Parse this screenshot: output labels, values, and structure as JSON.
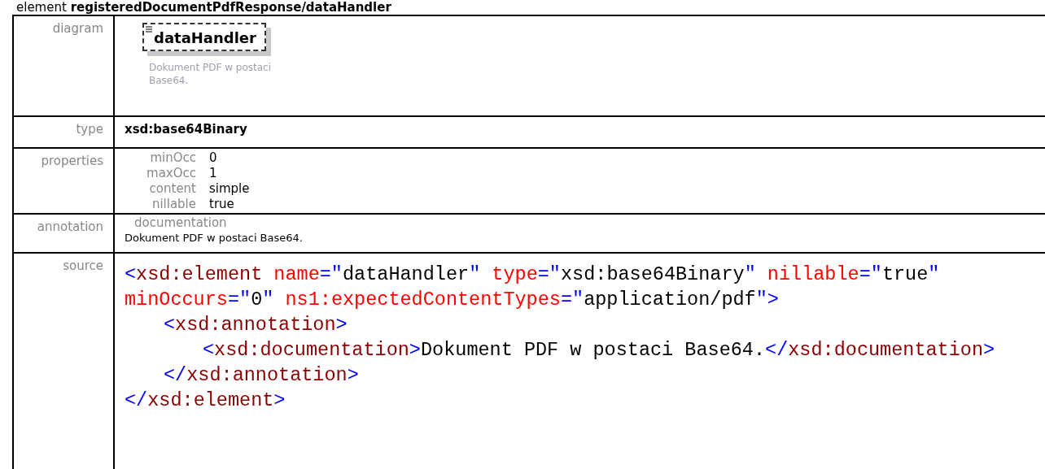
{
  "heading": {
    "prefix": "element",
    "name": "registeredDocumentPdfResponse/dataHandler"
  },
  "diagram": {
    "label": "diagram",
    "element": "dataHandler",
    "caption": "Dokument PDF w postaci Base64."
  },
  "type": {
    "label": "type",
    "value": "xsd:base64Binary"
  },
  "properties": {
    "label": "properties",
    "items": [
      {
        "name": "minOcc",
        "value": "0"
      },
      {
        "name": "maxOcc",
        "value": "1"
      },
      {
        "name": "content",
        "value": "simple"
      },
      {
        "name": "nillable",
        "value": "true"
      }
    ]
  },
  "annotation": {
    "label": "annotation",
    "heading": "documentation",
    "text": "Dokument PDF w postaci Base64."
  },
  "source": {
    "label": "source",
    "lines": [
      {
        "tokens": [
          {
            "kind": "punct",
            "text": "<"
          },
          {
            "kind": "tag",
            "text": "xsd:element "
          },
          {
            "kind": "attr",
            "text": "name"
          },
          {
            "kind": "punct",
            "text": "=\""
          },
          {
            "kind": "text",
            "text": "dataHandler"
          },
          {
            "kind": "punct",
            "text": "\" "
          },
          {
            "kind": "attr",
            "text": "type"
          },
          {
            "kind": "punct",
            "text": "=\""
          },
          {
            "kind": "text",
            "text": "xsd:base64Binary"
          },
          {
            "kind": "punct",
            "text": "\" "
          },
          {
            "kind": "attr",
            "text": "nillable"
          },
          {
            "kind": "punct",
            "text": "=\""
          },
          {
            "kind": "text",
            "text": "true"
          },
          {
            "kind": "punct",
            "text": "\""
          }
        ]
      },
      {
        "tokens": [
          {
            "kind": "attr",
            "text": "minOccurs"
          },
          {
            "kind": "punct",
            "text": "=\""
          },
          {
            "kind": "text",
            "text": "0"
          },
          {
            "kind": "punct",
            "text": "\" "
          },
          {
            "kind": "attr",
            "text": "ns1:expectedContentTypes"
          },
          {
            "kind": "punct",
            "text": "=\""
          },
          {
            "kind": "text",
            "text": "application/pdf"
          },
          {
            "kind": "punct",
            "text": "\">"
          }
        ],
        "children": [
          {
            "tokens": [
              {
                "kind": "punct",
                "text": "<"
              },
              {
                "kind": "tag",
                "text": "xsd:annotation"
              },
              {
                "kind": "punct",
                "text": ">"
              }
            ],
            "children": [
              {
                "tokens": [
                  {
                    "kind": "punct",
                    "text": "<"
                  },
                  {
                    "kind": "tag",
                    "text": "xsd:documentation"
                  },
                  {
                    "kind": "punct",
                    "text": ">"
                  },
                  {
                    "kind": "text",
                    "text": "Dokument PDF w postaci Base64."
                  },
                  {
                    "kind": "punct",
                    "text": "</"
                  },
                  {
                    "kind": "tag",
                    "text": "xsd:documentation"
                  },
                  {
                    "kind": "punct",
                    "text": ">"
                  }
                ]
              }
            ]
          },
          {
            "tokens": [
              {
                "kind": "punct",
                "text": "</"
              },
              {
                "kind": "tag",
                "text": "xsd:annotation"
              },
              {
                "kind": "punct",
                "text": ">"
              }
            ]
          }
        ]
      },
      {
        "tokens": [
          {
            "kind": "punct",
            "text": "</"
          },
          {
            "kind": "tag",
            "text": "xsd:element"
          },
          {
            "kind": "punct",
            "text": ">"
          }
        ]
      }
    ]
  }
}
